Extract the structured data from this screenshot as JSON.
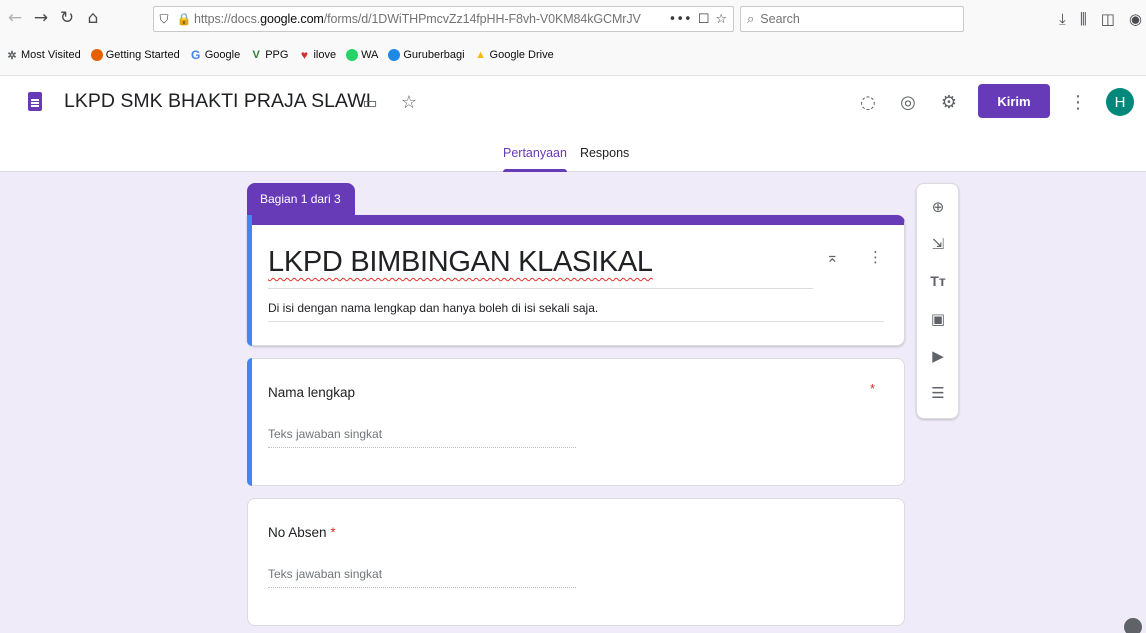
{
  "browser": {
    "url_prefix": "https://docs.",
    "url_domain": "google.com",
    "url_path": "/forms/d/1DWiTHPmcvZz14fpHH-F8vh-V0KM84kGCMrJV",
    "search_placeholder": "Search",
    "bookmarks": [
      {
        "label": "Most Visited",
        "icon": "gear-icon"
      },
      {
        "label": "Getting Started",
        "icon": "firefox-icon"
      },
      {
        "label": "Google",
        "icon": "google-icon"
      },
      {
        "label": "PPG",
        "icon": "ppg-icon"
      },
      {
        "label": "ilove",
        "icon": "heart-icon"
      },
      {
        "label": "WA",
        "icon": "whatsapp-icon"
      },
      {
        "label": "Guruberbagi",
        "icon": "guruberbagi-icon"
      },
      {
        "label": "Google Drive",
        "icon": "drive-icon"
      }
    ]
  },
  "forms": {
    "doc_title": "LKPD SMK BHAKTI PRAJA SLAWI",
    "send_label": "Kirim",
    "avatar_initial": "H",
    "accent": "#673ab7",
    "tabs": [
      {
        "label": "Pertanyaan",
        "active": true
      },
      {
        "label": "Respons",
        "active": false
      }
    ],
    "section_label": "Bagian 1 dari 3",
    "form_title": "LKPD BIMBINGAN KLASIKAL",
    "form_description": "Di isi dengan nama lengkap dan hanya boleh di isi sekali saja.",
    "questions": [
      {
        "label": "Nama lengkap",
        "placeholder": "Teks jawaban singkat",
        "required": "*"
      },
      {
        "label": "No Absen",
        "placeholder": "Teks jawaban singkat",
        "required": "*"
      }
    ]
  }
}
